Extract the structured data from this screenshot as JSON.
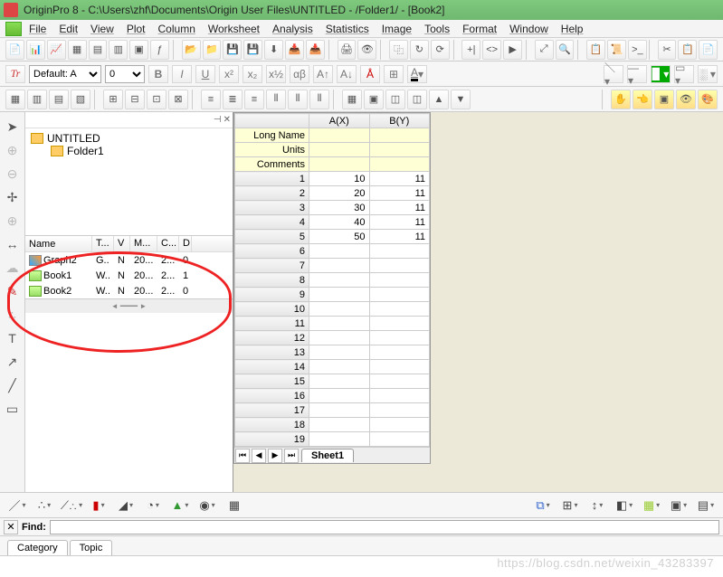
{
  "title": "OriginPro 8 - C:\\Users\\zhf\\Documents\\Origin User Files\\UNTITLED - /Folder1/ - [Book2]",
  "menus": [
    "File",
    "Edit",
    "View",
    "Plot",
    "Column",
    "Worksheet",
    "Analysis",
    "Statistics",
    "Image",
    "Tools",
    "Format",
    "Window",
    "Help"
  ],
  "font_label": "Default: A",
  "font_size": "0",
  "tree": {
    "root": "UNTITLED",
    "child": "Folder1"
  },
  "proj_headers": {
    "name": "Name",
    "t": "T...",
    "v": "V",
    "m": "M...",
    "c": "C...",
    "d": "D"
  },
  "proj_rows": [
    {
      "icon": "graph",
      "name": "Graph2",
      "t": "G..",
      "v": "N",
      "m": "20...",
      "c": "2...",
      "d": "0"
    },
    {
      "icon": "book",
      "name": "Book1",
      "t": "W..",
      "v": "N",
      "m": "20...",
      "c": "2...",
      "d": "1"
    },
    {
      "icon": "book",
      "name": "Book2",
      "t": "W..",
      "v": "N",
      "m": "20...",
      "c": "2...",
      "d": "0"
    }
  ],
  "col_headers": [
    "A(X)",
    "B(Y)"
  ],
  "meta_rows": [
    "Long Name",
    "Units",
    "Comments"
  ],
  "data_rows": [
    {
      "n": "1",
      "a": "10",
      "b": "11"
    },
    {
      "n": "2",
      "a": "20",
      "b": "11"
    },
    {
      "n": "3",
      "a": "30",
      "b": "11"
    },
    {
      "n": "4",
      "a": "40",
      "b": "11"
    },
    {
      "n": "5",
      "a": "50",
      "b": "11"
    },
    {
      "n": "6",
      "a": "",
      "b": ""
    },
    {
      "n": "7",
      "a": "",
      "b": ""
    },
    {
      "n": "8",
      "a": "",
      "b": ""
    },
    {
      "n": "9",
      "a": "",
      "b": ""
    },
    {
      "n": "10",
      "a": "",
      "b": ""
    },
    {
      "n": "11",
      "a": "",
      "b": ""
    },
    {
      "n": "12",
      "a": "",
      "b": ""
    },
    {
      "n": "13",
      "a": "",
      "b": ""
    },
    {
      "n": "14",
      "a": "",
      "b": ""
    },
    {
      "n": "15",
      "a": "",
      "b": ""
    },
    {
      "n": "16",
      "a": "",
      "b": ""
    },
    {
      "n": "17",
      "a": "",
      "b": ""
    },
    {
      "n": "18",
      "a": "",
      "b": ""
    },
    {
      "n": "19",
      "a": "",
      "b": ""
    }
  ],
  "sheet_tab": "Sheet1",
  "find_label": "Find:",
  "cat_tabs": [
    "Category",
    "Topic"
  ],
  "watermark": "https://blog.csdn.net/weixin_43283397",
  "chart_data": {
    "type": "table",
    "columns": [
      "A(X)",
      "B(Y)"
    ],
    "rows": [
      [
        10,
        11
      ],
      [
        20,
        11
      ],
      [
        30,
        11
      ],
      [
        40,
        11
      ],
      [
        50,
        11
      ]
    ]
  }
}
